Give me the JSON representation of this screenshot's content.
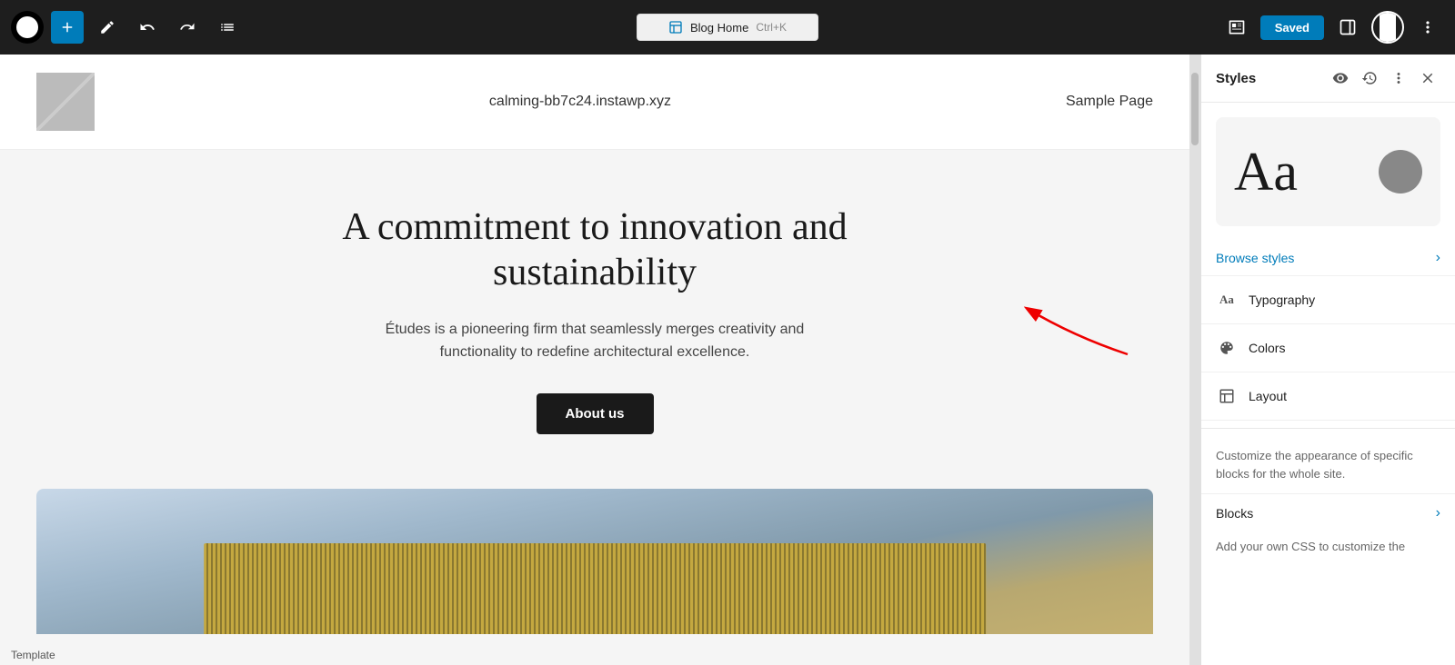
{
  "toolbar": {
    "add_label": "+",
    "page_title": "Blog Home",
    "shortcut": "Ctrl+K",
    "saved_label": "Saved",
    "more_label": "⋮"
  },
  "site": {
    "url": "calming-bb7c24.instawp.xyz",
    "nav": "Sample Page",
    "hero_title": "A commitment to innovation and sustainability",
    "hero_subtitle": "Études is a pioneering firm that seamlessly merges creativity and functionality to redefine architectural excellence.",
    "about_btn": "About us"
  },
  "styles_panel": {
    "title": "Styles",
    "preview_text": "Aa",
    "browse_styles": "Browse styles",
    "typography_label": "Typography",
    "colors_label": "Colors",
    "layout_label": "Layout",
    "description": "Customize the appearance of specific blocks for the whole site.",
    "blocks_label": "Blocks",
    "css_label": "Add your own CSS to customize the"
  },
  "status_bar": {
    "label": "Template"
  }
}
